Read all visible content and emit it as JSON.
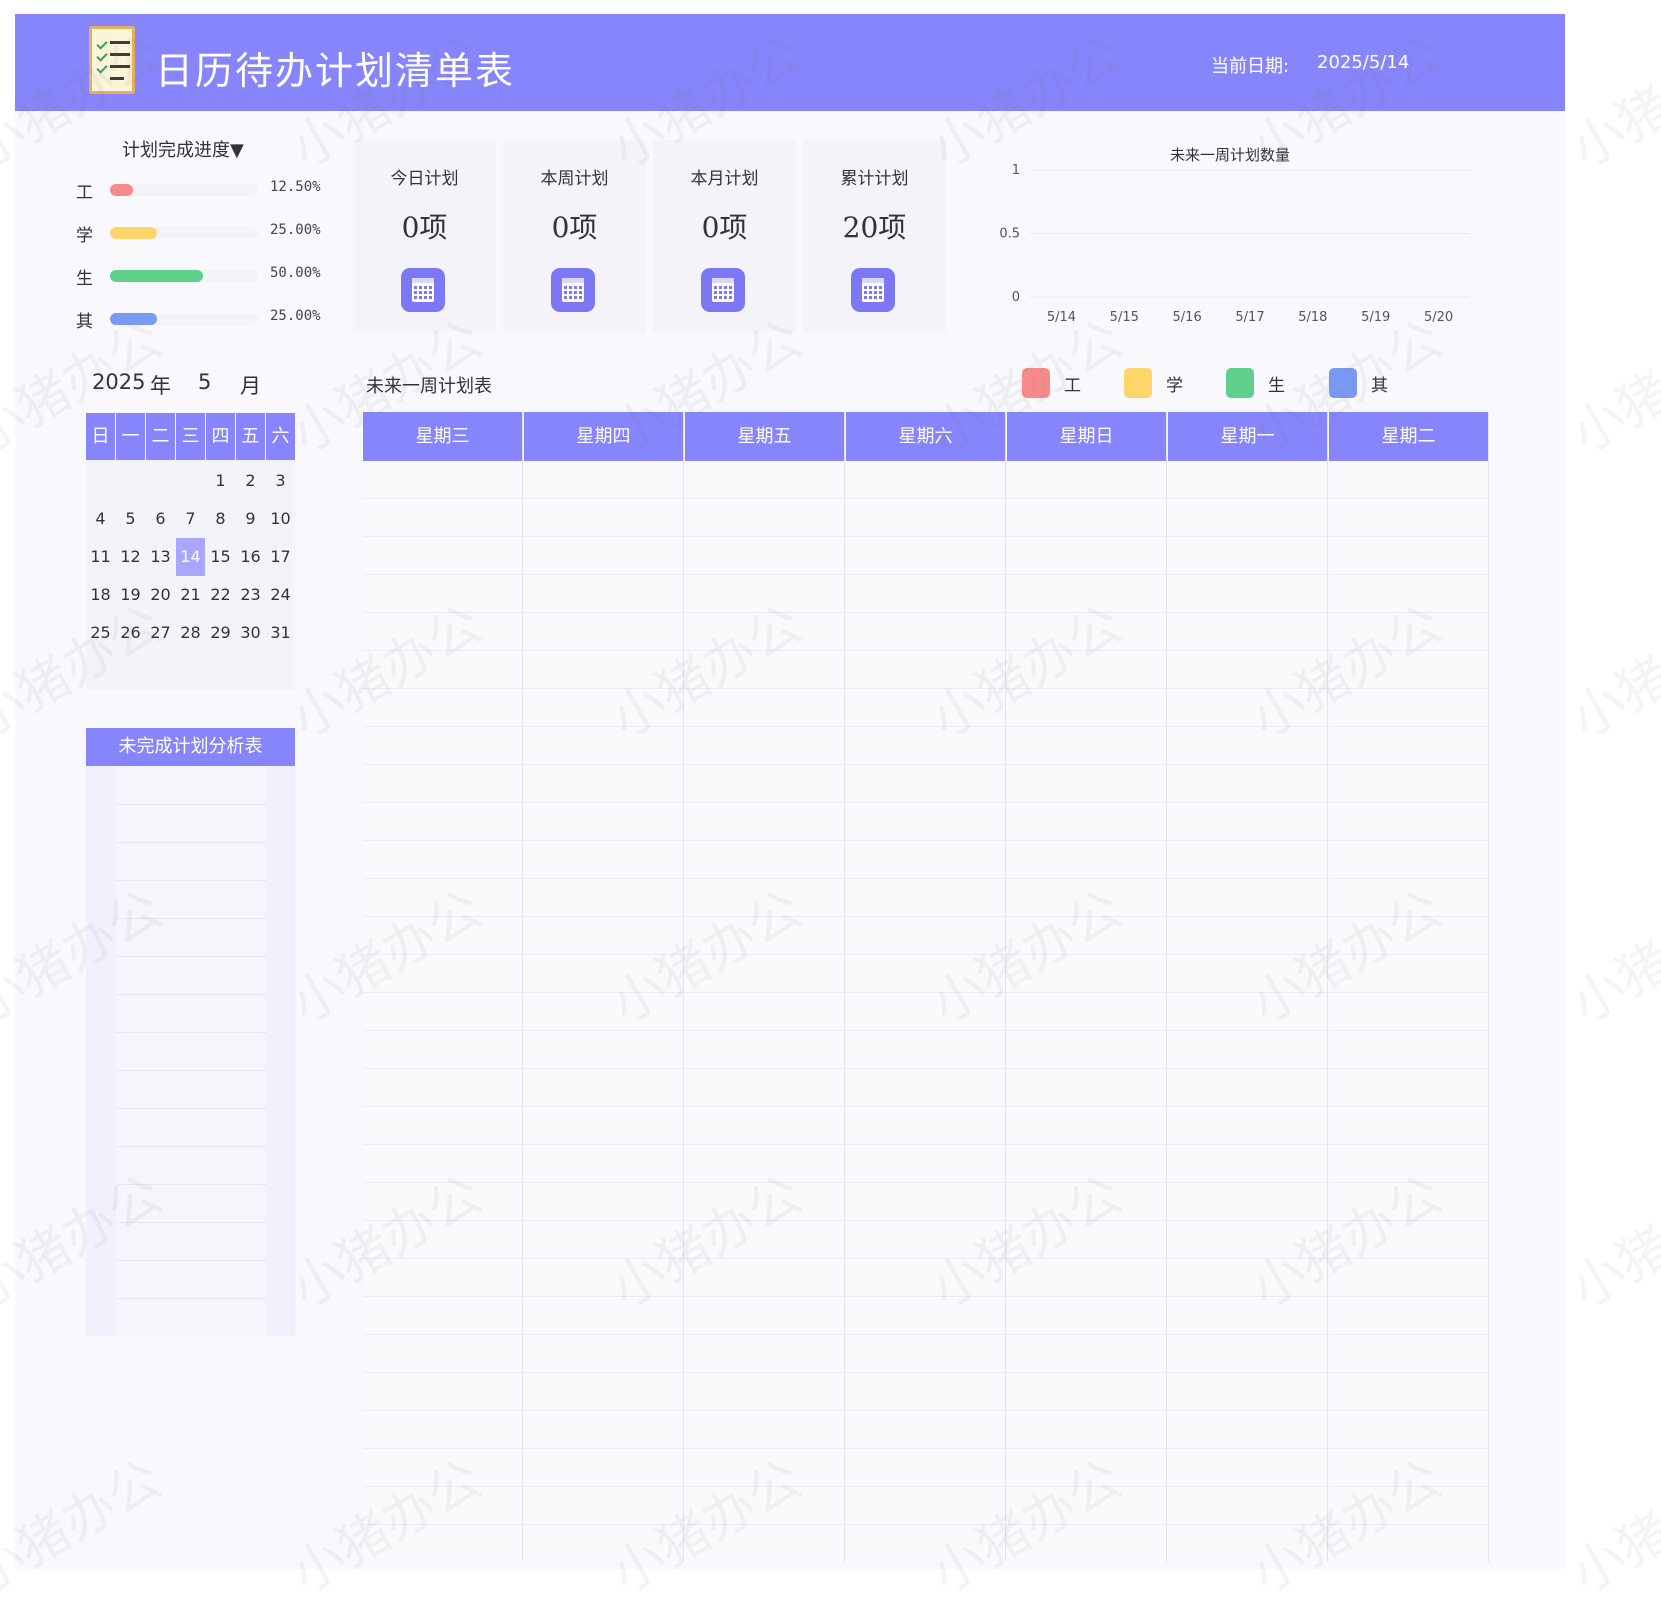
{
  "header": {
    "title": "日历待办计划清单表",
    "date_label": "当前日期:",
    "date_value": "2025/5/14"
  },
  "progress": {
    "title": "计划完成进度▼",
    "items": [
      {
        "label": "工",
        "percent_text": "12.50%",
        "value": 0.125,
        "color": "#f78a8a"
      },
      {
        "label": "学",
        "percent_text": "25.00%",
        "value": 0.25,
        "color": "#fdd56a"
      },
      {
        "label": "生",
        "percent_text": "50.00%",
        "value": 0.5,
        "color": "#5fcf8c"
      },
      {
        "label": "其",
        "percent_text": "25.00%",
        "value": 0.25,
        "color": "#7999f5"
      }
    ]
  },
  "stats": [
    {
      "label": "今日计划",
      "value": "0项"
    },
    {
      "label": "本周计划",
      "value": "0项"
    },
    {
      "label": "本月计划",
      "value": "0项"
    },
    {
      "label": "累计计划",
      "value": "20项"
    }
  ],
  "chart_data": {
    "type": "bar",
    "title": "未来一周计划数量",
    "categories": [
      "5/14",
      "5/15",
      "5/16",
      "5/17",
      "5/18",
      "5/19",
      "5/20"
    ],
    "values": [
      0,
      0,
      0,
      0,
      0,
      0,
      0
    ],
    "yticks": [
      "1",
      "0.5",
      "0"
    ],
    "ylim": [
      0,
      1
    ],
    "grid": true
  },
  "calendar": {
    "year": "2025",
    "year_suffix": "年",
    "month": "5",
    "month_suffix": "月",
    "weekdays": [
      "日",
      "一",
      "二",
      "三",
      "四",
      "五",
      "六"
    ],
    "first_weekday": 4,
    "days_in_month": 31,
    "today": 14,
    "highlight_color": "#a9a6fb"
  },
  "analysis": {
    "title": "未完成计划分析表"
  },
  "week_plan": {
    "title": "未来一周计划表",
    "legend": [
      {
        "label": "工",
        "color": "#f78a8a"
      },
      {
        "label": "学",
        "color": "#fdd56a"
      },
      {
        "label": "生",
        "color": "#5fcf8c"
      },
      {
        "label": "其",
        "color": "#7999f5"
      }
    ],
    "days": [
      "星期三",
      "星期四",
      "星期五",
      "星期六",
      "星期日",
      "星期一",
      "星期二"
    ]
  },
  "watermark": "小猪办公",
  "colors": {
    "accent": "#8785fb"
  }
}
